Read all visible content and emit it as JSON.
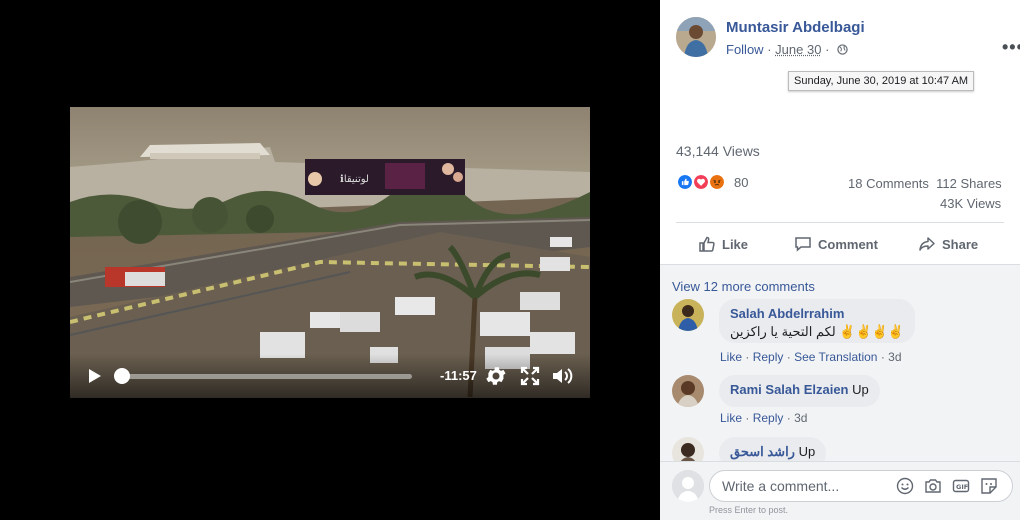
{
  "video": {
    "time_remaining": "-11:57",
    "progress_fraction": 0.02,
    "billboard_text": "ℹلوتنيقا"
  },
  "post": {
    "author": "Muntasir Abdelbagi",
    "follow_label": "Follow",
    "date": "June 30",
    "date_sep": "·",
    "tooltip": "Sunday, June 30, 2019 at 10:47 AM",
    "more_label": "•••",
    "views": "43,144 Views",
    "reaction_count": "80",
    "comments_count": "18 Comments",
    "shares_count": "112 Shares",
    "video_views": "43K Views"
  },
  "actions": {
    "like": "Like",
    "comment": "Comment",
    "share": "Share"
  },
  "comments": {
    "view_more": "View 12 more comments",
    "items": [
      {
        "name": "Salah Abdelrrahim",
        "text": "لكم التحية يا راكزين ✌️✌️✌️✌️",
        "like": "Like",
        "reply": "Reply",
        "translate": "See Translation",
        "age": "3d"
      },
      {
        "name": "Rami Salah Elzaien",
        "text": "Up",
        "like": "Like",
        "reply": "Reply",
        "age": "3d"
      },
      {
        "name": "راشد اسحق",
        "text": "Up"
      }
    ],
    "sep": "·"
  },
  "composer": {
    "placeholder": "Write a comment...",
    "hint": "Press Enter to post."
  },
  "colors": {
    "link": "#385898",
    "meta": "#606770",
    "like_blue": "#1877f2",
    "love_red": "#f33e58",
    "angry_orange": "#e9710f"
  }
}
